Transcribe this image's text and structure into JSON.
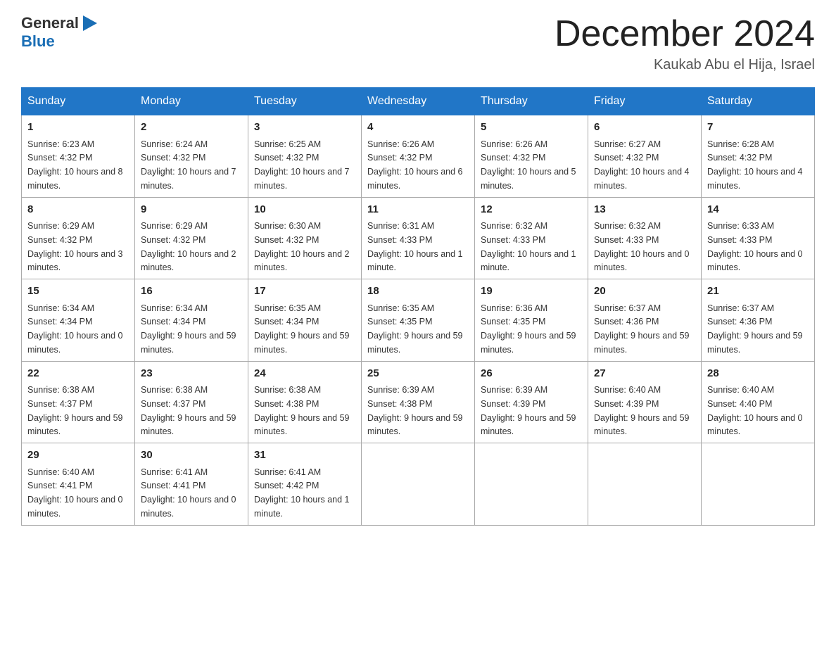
{
  "header": {
    "logo_general": "General",
    "logo_blue": "Blue",
    "month_title": "December 2024",
    "location": "Kaukab Abu el Hija, Israel"
  },
  "weekdays": [
    "Sunday",
    "Monday",
    "Tuesday",
    "Wednesday",
    "Thursday",
    "Friday",
    "Saturday"
  ],
  "weeks": [
    [
      {
        "day": "1",
        "sunrise": "6:23 AM",
        "sunset": "4:32 PM",
        "daylight": "10 hours and 8 minutes."
      },
      {
        "day": "2",
        "sunrise": "6:24 AM",
        "sunset": "4:32 PM",
        "daylight": "10 hours and 7 minutes."
      },
      {
        "day": "3",
        "sunrise": "6:25 AM",
        "sunset": "4:32 PM",
        "daylight": "10 hours and 7 minutes."
      },
      {
        "day": "4",
        "sunrise": "6:26 AM",
        "sunset": "4:32 PM",
        "daylight": "10 hours and 6 minutes."
      },
      {
        "day": "5",
        "sunrise": "6:26 AM",
        "sunset": "4:32 PM",
        "daylight": "10 hours and 5 minutes."
      },
      {
        "day": "6",
        "sunrise": "6:27 AM",
        "sunset": "4:32 PM",
        "daylight": "10 hours and 4 minutes."
      },
      {
        "day": "7",
        "sunrise": "6:28 AM",
        "sunset": "4:32 PM",
        "daylight": "10 hours and 4 minutes."
      }
    ],
    [
      {
        "day": "8",
        "sunrise": "6:29 AM",
        "sunset": "4:32 PM",
        "daylight": "10 hours and 3 minutes."
      },
      {
        "day": "9",
        "sunrise": "6:29 AM",
        "sunset": "4:32 PM",
        "daylight": "10 hours and 2 minutes."
      },
      {
        "day": "10",
        "sunrise": "6:30 AM",
        "sunset": "4:32 PM",
        "daylight": "10 hours and 2 minutes."
      },
      {
        "day": "11",
        "sunrise": "6:31 AM",
        "sunset": "4:33 PM",
        "daylight": "10 hours and 1 minute."
      },
      {
        "day": "12",
        "sunrise": "6:32 AM",
        "sunset": "4:33 PM",
        "daylight": "10 hours and 1 minute."
      },
      {
        "day": "13",
        "sunrise": "6:32 AM",
        "sunset": "4:33 PM",
        "daylight": "10 hours and 0 minutes."
      },
      {
        "day": "14",
        "sunrise": "6:33 AM",
        "sunset": "4:33 PM",
        "daylight": "10 hours and 0 minutes."
      }
    ],
    [
      {
        "day": "15",
        "sunrise": "6:34 AM",
        "sunset": "4:34 PM",
        "daylight": "10 hours and 0 minutes."
      },
      {
        "day": "16",
        "sunrise": "6:34 AM",
        "sunset": "4:34 PM",
        "daylight": "9 hours and 59 minutes."
      },
      {
        "day": "17",
        "sunrise": "6:35 AM",
        "sunset": "4:34 PM",
        "daylight": "9 hours and 59 minutes."
      },
      {
        "day": "18",
        "sunrise": "6:35 AM",
        "sunset": "4:35 PM",
        "daylight": "9 hours and 59 minutes."
      },
      {
        "day": "19",
        "sunrise": "6:36 AM",
        "sunset": "4:35 PM",
        "daylight": "9 hours and 59 minutes."
      },
      {
        "day": "20",
        "sunrise": "6:37 AM",
        "sunset": "4:36 PM",
        "daylight": "9 hours and 59 minutes."
      },
      {
        "day": "21",
        "sunrise": "6:37 AM",
        "sunset": "4:36 PM",
        "daylight": "9 hours and 59 minutes."
      }
    ],
    [
      {
        "day": "22",
        "sunrise": "6:38 AM",
        "sunset": "4:37 PM",
        "daylight": "9 hours and 59 minutes."
      },
      {
        "day": "23",
        "sunrise": "6:38 AM",
        "sunset": "4:37 PM",
        "daylight": "9 hours and 59 minutes."
      },
      {
        "day": "24",
        "sunrise": "6:38 AM",
        "sunset": "4:38 PM",
        "daylight": "9 hours and 59 minutes."
      },
      {
        "day": "25",
        "sunrise": "6:39 AM",
        "sunset": "4:38 PM",
        "daylight": "9 hours and 59 minutes."
      },
      {
        "day": "26",
        "sunrise": "6:39 AM",
        "sunset": "4:39 PM",
        "daylight": "9 hours and 59 minutes."
      },
      {
        "day": "27",
        "sunrise": "6:40 AM",
        "sunset": "4:39 PM",
        "daylight": "9 hours and 59 minutes."
      },
      {
        "day": "28",
        "sunrise": "6:40 AM",
        "sunset": "4:40 PM",
        "daylight": "10 hours and 0 minutes."
      }
    ],
    [
      {
        "day": "29",
        "sunrise": "6:40 AM",
        "sunset": "4:41 PM",
        "daylight": "10 hours and 0 minutes."
      },
      {
        "day": "30",
        "sunrise": "6:41 AM",
        "sunset": "4:41 PM",
        "daylight": "10 hours and 0 minutes."
      },
      {
        "day": "31",
        "sunrise": "6:41 AM",
        "sunset": "4:42 PM",
        "daylight": "10 hours and 1 minute."
      },
      null,
      null,
      null,
      null
    ]
  ]
}
